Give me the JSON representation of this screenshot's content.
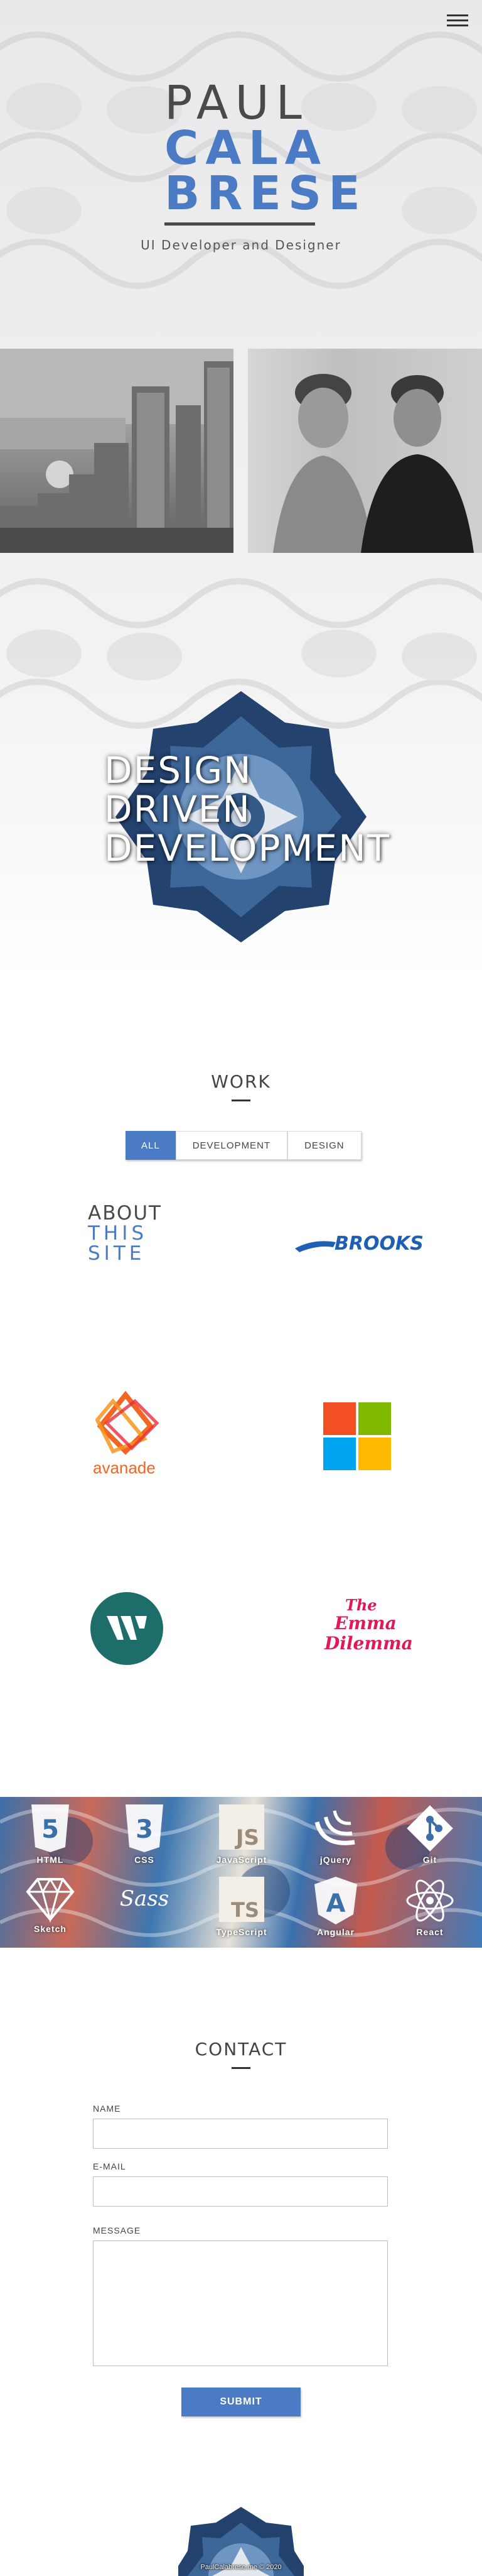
{
  "header": {
    "menu_icon": "hamburger-icon"
  },
  "hero": {
    "logo_line_1": "PAUL",
    "logo_line_2": "CALA",
    "logo_line_3": "BRESE",
    "tagline": "UI Developer and Designer",
    "tagline_lines": [
      "DESIGN",
      "DRIVEN",
      "DEVELOPMENT"
    ]
  },
  "work": {
    "title": "WORK",
    "filters": [
      "ALL",
      "DEVELOPMENT",
      "DESIGN"
    ],
    "active_filter": "ALL",
    "items": [
      {
        "name": "about-this-site",
        "lines": [
          "ABOUT",
          "THIS",
          "SITE"
        ]
      },
      {
        "name": "brooks",
        "text": "BROOKS"
      },
      {
        "name": "avanade",
        "text": "avanade"
      },
      {
        "name": "microsoft",
        "text": ""
      },
      {
        "name": "w-logo",
        "text": ""
      },
      {
        "name": "emma-dilemma",
        "lines": [
          "The",
          "Emma",
          "Dilemma"
        ]
      }
    ]
  },
  "skills": [
    {
      "label": "HTML",
      "icon": "html5-icon"
    },
    {
      "label": "CSS",
      "icon": "css3-icon"
    },
    {
      "label": "JavaScript",
      "icon": "javascript-icon"
    },
    {
      "label": "jQuery",
      "icon": "jquery-icon"
    },
    {
      "label": "Git",
      "icon": "git-icon"
    },
    {
      "label": "Sketch",
      "icon": "sketch-icon"
    },
    {
      "label": "Sass",
      "icon": "sass-icon"
    },
    {
      "label": "TypeScript",
      "icon": "typescript-icon"
    },
    {
      "label": "Angular",
      "icon": "angular-icon"
    },
    {
      "label": "React",
      "icon": "react-icon"
    }
  ],
  "contact": {
    "title": "CONTACT",
    "name_label": "NAME",
    "email_label": "E-MAIL",
    "message_label": "MESSAGE",
    "name_value": "",
    "email_value": "",
    "message_value": "",
    "submit_label": "SUBMIT"
  },
  "footer": {
    "copyright": "PaulCalabrese.me © 2020"
  },
  "colors": {
    "accent": "#4b7bc4",
    "text": "#444444",
    "brooks": "#1f5fb3",
    "avanade": "#f26522",
    "emma": "#e0195a",
    "w_teal": "#1d6e6a"
  }
}
